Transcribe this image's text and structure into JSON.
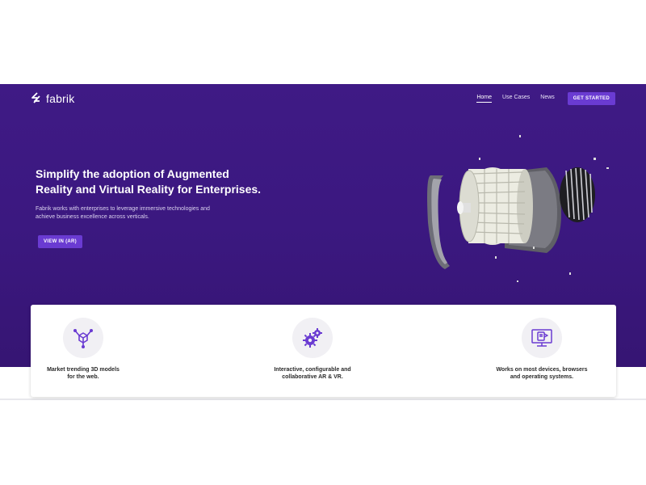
{
  "header": {
    "logo_text": "fabrik",
    "nav": [
      {
        "label": "Home",
        "active": true
      },
      {
        "label": "Use Cases",
        "active": false
      },
      {
        "label": "News",
        "active": false
      }
    ],
    "cta_label": "GET STARTED"
  },
  "hero": {
    "headline_line1": "Simplify the adoption of Augmented",
    "headline_line2": "Reality and Virtual Reality for Enterprises.",
    "subtext_line1": "Fabrik works with enterprises to leverage immersive technologies and",
    "subtext_line2": "achieve business excellence across verticals.",
    "button_label": "VIEW IN (AR)"
  },
  "features": [
    {
      "icon": "3d-cube-network-icon",
      "line1": "Market trending 3D models",
      "line2": "for the web."
    },
    {
      "icon": "gears-icon",
      "line1": "Interactive, configurable and",
      "line2": "collaborative AR & VR."
    },
    {
      "icon": "monitor-devices-icon",
      "line1": "Works on most devices, browsers",
      "line2": "and operating systems."
    }
  ],
  "colors": {
    "hero_background": "#3d1a82",
    "accent": "#6a3bd2",
    "icon_purple": "#6a3bd2",
    "text_dark": "#2a2a2a"
  }
}
